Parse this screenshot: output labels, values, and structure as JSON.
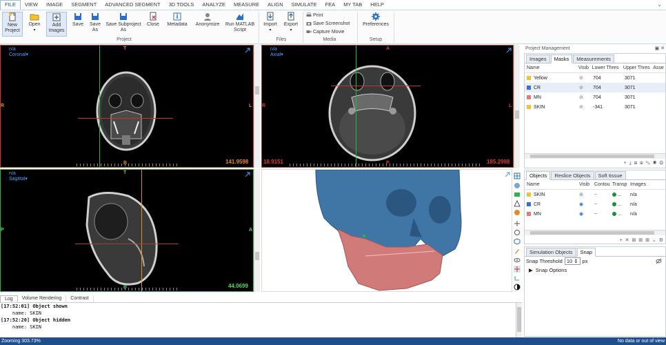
{
  "menu": [
    "FILE",
    "VIEW",
    "IMAGE",
    "SEGMENT",
    "ADVANCED SEGMENT",
    "3D TOOLS",
    "ANALYZE",
    "MEASURE",
    "ALIGN",
    "SIMULATE",
    "FEA",
    "MY TAB",
    "HELP"
  ],
  "ribbon": {
    "new_project": "New Project",
    "open": "Open",
    "add_images": "Add Images",
    "save": "Save",
    "save_as": "Save As",
    "save_subproject": "Save Subproject As",
    "close": "Close",
    "metadata": "Metadata",
    "anonymize": "Anonymize",
    "run_matlab": "Run MATLAB Script",
    "project_group": "Project",
    "import": "Import",
    "export": "Export",
    "files_group": "Files",
    "print": "Print",
    "save_screenshot": "Save Screenshot",
    "capture_movie": "Capture Movie",
    "media_group": "Media",
    "preferences": "Preferences",
    "setup_group": "Setup"
  },
  "views": {
    "coronal": {
      "name": "n/a",
      "plane": "Coronal",
      "top": "T",
      "bottom": "B",
      "left": "R",
      "right": "L",
      "value": "141.9598"
    },
    "axial": {
      "name": "n/a",
      "plane": "Axial",
      "top": "A",
      "bottom": "P",
      "left": "R",
      "right": "L",
      "value_left": "18.9151",
      "value_right": "185.2998"
    },
    "sagittal": {
      "name": "n/a",
      "plane": "Sagittal",
      "top": "T",
      "bottom": "B",
      "left": "P",
      "right": "A",
      "value": "44.0699"
    }
  },
  "project_management": {
    "title": "Project Management",
    "tabs": [
      "Images",
      "Masks",
      "Measurements"
    ],
    "active_tab": "Masks",
    "columns": [
      "Name",
      "Visib",
      "Lower Thres",
      "Upper Thres",
      "Asse"
    ],
    "masks": [
      {
        "name": "Yellow",
        "color": "#f2c230",
        "lower": "704",
        "upper": "3071"
      },
      {
        "name": "CR",
        "color": "#3a6fd1",
        "lower": "704",
        "upper": "3071"
      },
      {
        "name": "MN",
        "color": "#e07b7b",
        "lower": "704",
        "upper": "3071"
      },
      {
        "name": "SKIN",
        "color": "#f2c230",
        "lower": "-341",
        "upper": "3071"
      }
    ]
  },
  "objects_panel": {
    "tabs": [
      "Objects",
      "Reslice Objects",
      "Soft tissue"
    ],
    "active_tab": "Objects",
    "columns": [
      "Name",
      "Visib",
      "Contou",
      "Transp",
      "Images"
    ],
    "rows": [
      {
        "name": "SKIN",
        "color": "#f2c230",
        "transp": "...",
        "images": "n/a"
      },
      {
        "name": "CR",
        "color": "#3a6fd1",
        "transp": "...",
        "images": "n/a"
      },
      {
        "name": "MN",
        "color": "#e07b7b",
        "transp": "...",
        "images": "n/a"
      }
    ]
  },
  "snap_panel": {
    "tabs": [
      "Simulation Objects",
      "Snap"
    ],
    "active_tab": "Snap",
    "threshold_label": "Snap Threshold",
    "threshold_value": "10",
    "unit": "px",
    "options_label": "Snap Options"
  },
  "log": {
    "tabs": [
      "Log",
      "Volume Rendering",
      "Contrast"
    ],
    "active_tab": "Log",
    "lines": [
      "[17:52:01] Object shown",
      "    name: SKIN",
      "[17:52:20] Object hidden",
      "    name: SKIN"
    ]
  },
  "status": {
    "left": "Zooming 303.73%",
    "right": "No data or out of view"
  },
  "colors": {
    "accent": "#1f4e8c",
    "skull_blue": "#3f76a6",
    "mandible_red": "#d07a7a"
  }
}
